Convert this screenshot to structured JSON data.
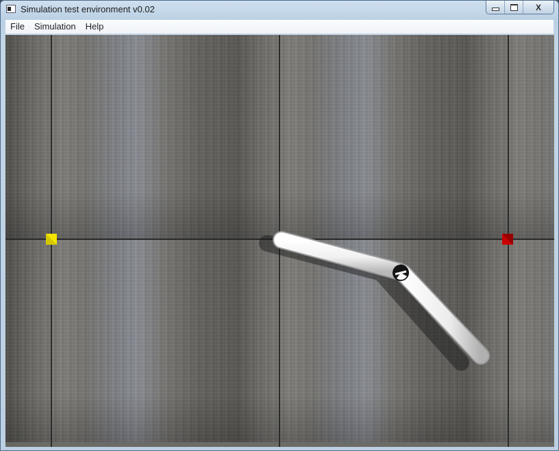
{
  "window": {
    "title": "Simulation test environment v0.02",
    "controls": {
      "minimize_icon": "minimize-icon",
      "maximize_icon": "maximize-icon",
      "close_label": "X"
    }
  },
  "menu": {
    "items": [
      "File",
      "Simulation",
      "Help"
    ]
  },
  "scene": {
    "start_marker_color": "#f2e400",
    "goal_marker_color": "#c80000",
    "arm_color": "#ffffff",
    "joint_icon": "joint-icon"
  }
}
